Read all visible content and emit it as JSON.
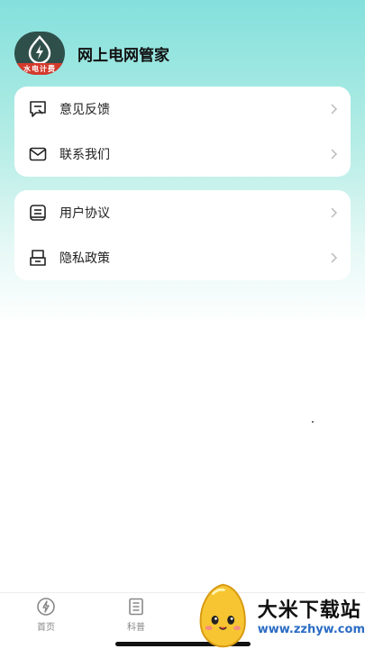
{
  "header": {
    "app_title": "网上电网管家",
    "logo_band_text": "水电计费",
    "logo_icon": "lightning-drop-icon"
  },
  "menu": {
    "group1": [
      {
        "label": "意见反馈",
        "icon": "feedback-icon"
      },
      {
        "label": "联系我们",
        "icon": "mail-icon"
      }
    ],
    "group2": [
      {
        "label": "用户协议",
        "icon": "agreement-icon"
      },
      {
        "label": "隐私政策",
        "icon": "privacy-icon"
      }
    ]
  },
  "tabbar": {
    "tabs": [
      {
        "label": "首页",
        "icon": "home-bolt-icon"
      },
      {
        "label": "科普",
        "icon": "article-icon"
      }
    ]
  },
  "watermark": {
    "title": "大米下载站",
    "url": "www.zzhyw.com"
  },
  "colors": {
    "gradient_top": "#84e0dc",
    "logo_red": "#d33a2c",
    "url_blue": "#2b6cc4"
  }
}
